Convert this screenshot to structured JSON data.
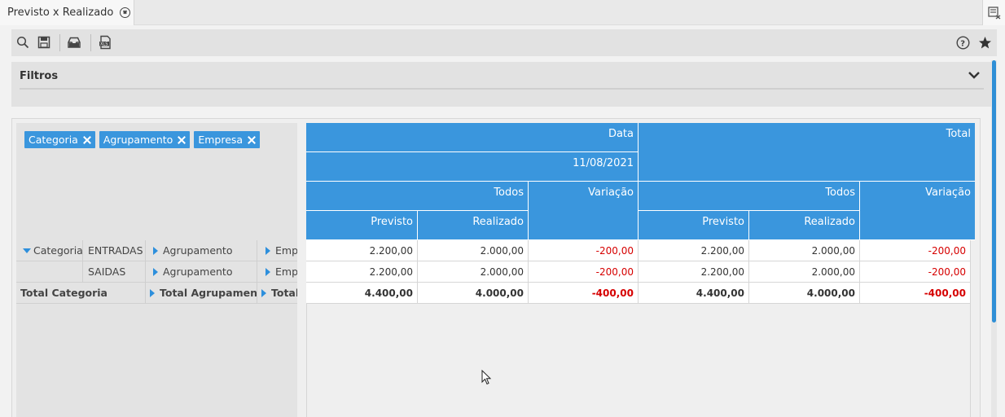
{
  "tab": {
    "title": "Previsto x Realizado"
  },
  "filters": {
    "title": "Filtros"
  },
  "chips": [
    {
      "label": "Categoria"
    },
    {
      "label": "Agrupamento"
    },
    {
      "label": "Empresa"
    }
  ],
  "rows": {
    "header_label": "Categoria",
    "items": [
      {
        "label": "ENTRADAS",
        "agr": "Agrupamento",
        "emp": "Empr"
      },
      {
        "label": "SAIDAS",
        "agr": "Agrupamento",
        "emp": "Empr"
      }
    ],
    "total": {
      "label": "Total Categoria",
      "agr": "Total Agrupamento",
      "emp": "Total"
    }
  },
  "columns": {
    "data_label": "Data",
    "date": "11/08/2021",
    "total_label": "Total",
    "todos": "Todos",
    "variacao": "Variação",
    "previsto": "Previsto",
    "realizado": "Realizado"
  },
  "values": [
    [
      "2.200,00",
      "2.000,00",
      "-200,00",
      "2.200,00",
      "2.000,00",
      "-200,00"
    ],
    [
      "2.200,00",
      "2.000,00",
      "-200,00",
      "2.200,00",
      "2.000,00",
      "-200,00"
    ],
    [
      "4.400,00",
      "4.000,00",
      "-400,00",
      "4.400,00",
      "4.000,00",
      "-400,00"
    ]
  ],
  "colors": {
    "accent": "#3a96dd",
    "negative": "#d60000"
  },
  "icons": [
    "search-icon",
    "save-icon",
    "inbox-icon",
    "export-xls-icon",
    "help-icon",
    "star-icon",
    "tab-close-icon",
    "tab-list-icon",
    "chevron-down-icon"
  ]
}
